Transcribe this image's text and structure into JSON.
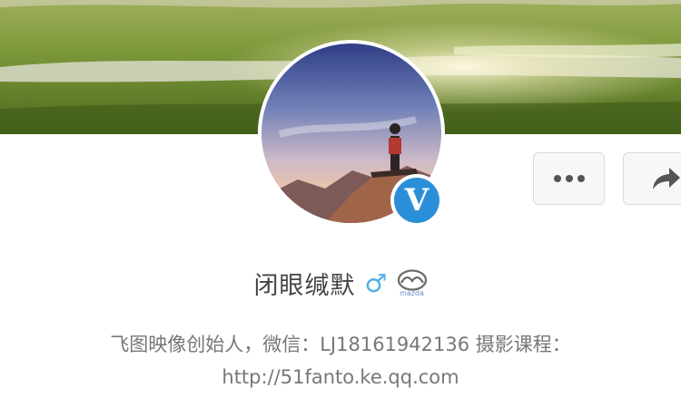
{
  "profile": {
    "name": "闭眼缄默",
    "gender_symbol": "♂",
    "brand_badge": "mazda",
    "verified_mark": "V",
    "bio_line1": "飞图映像创始人，微信：LJ18161942136 摄影课程：",
    "bio_line2": "http://51fanto.ke.qq.com"
  },
  "actions": {
    "more_icon": "more-dots-icon",
    "share_icon": "share-arrow-icon"
  },
  "colors": {
    "verified_blue": "#2a8fd8",
    "gender_blue": "#52b0e6",
    "text_dark": "#444444",
    "text_gray": "#777777"
  }
}
